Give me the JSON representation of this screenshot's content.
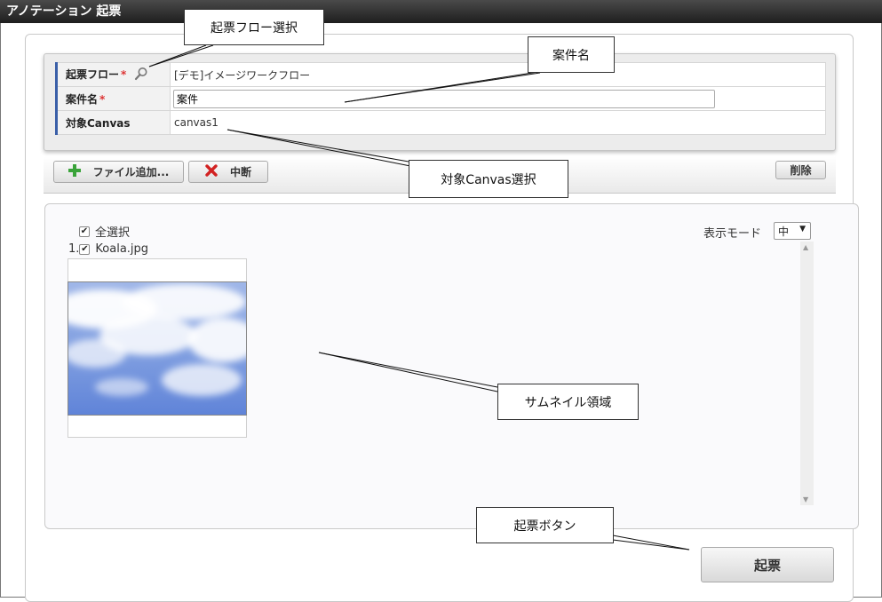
{
  "window": {
    "title": "アノテーション 起票"
  },
  "form": {
    "rows": [
      {
        "label": "起票フロー",
        "required": "*",
        "value": "[デモ]イメージワークフロー"
      },
      {
        "label": "案件名",
        "required": "*",
        "value": "案件"
      },
      {
        "label": "対象Canvas",
        "required": "",
        "value": "canvas1"
      }
    ]
  },
  "toolbar": {
    "add_file_label": "ファイル追加...",
    "abort_label": "中断",
    "delete_label": "削除"
  },
  "thumbnails": {
    "select_all_label": "全選択",
    "display_mode_label": "表示モード",
    "display_mode_value": "中",
    "items": [
      {
        "index": "1.",
        "filename": "Koala.jpg",
        "checked": true
      }
    ]
  },
  "submit_label": "起票",
  "callouts": {
    "flow_select": "起票フロー選択",
    "case_name": "案件名",
    "canvas_select": "対象Canvas選択",
    "thumb_area": "サムネイル領域",
    "submit_button": "起票ボタン"
  },
  "colors": {
    "titlebar": "#2b2b2b",
    "label_accent": "#3a5fa8",
    "required": "#dd3333",
    "add_icon": "#3aa33a",
    "abort_icon": "#d22222"
  }
}
